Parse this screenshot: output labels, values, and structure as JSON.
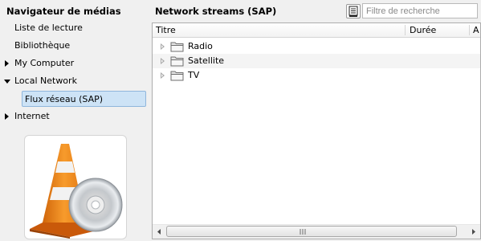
{
  "sidebar": {
    "title": "Navigateur de médias",
    "items": [
      {
        "label": "Liste de lecture"
      },
      {
        "label": "Bibliothèque"
      },
      {
        "label": "My Computer"
      },
      {
        "label": "Local Network"
      },
      {
        "label": "Flux réseau (SAP)"
      },
      {
        "label": "Internet"
      }
    ]
  },
  "main": {
    "title": "Network streams (SAP)",
    "search_placeholder": "Filtre de recherche",
    "columns": [
      "Titre",
      "Durée",
      "A"
    ],
    "rows": [
      {
        "label": "Radio"
      },
      {
        "label": "Satellite"
      },
      {
        "label": "TV"
      }
    ]
  },
  "icons": {
    "view_toggle": "playlist-view-icon",
    "art": "vlc-cone-with-disc-icon",
    "folder": "folder-icon",
    "expander": "expand-arrow-icon"
  },
  "colors": {
    "selection": "#cde3f6",
    "cone_orange": "#f28a1a",
    "row_alt": "#f4f4f4"
  }
}
